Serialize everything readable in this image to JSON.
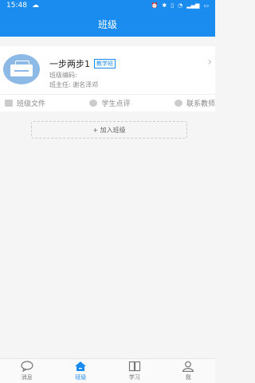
{
  "status": {
    "time": "15:48",
    "icons": [
      "cloud-icon",
      "battery-icon"
    ]
  },
  "header": {
    "title": "班级"
  },
  "class_card": {
    "name": "一步两步1",
    "badge": "教学班",
    "code_label": "班级编码:",
    "teacher_label": "班主任: 谢名泽邓"
  },
  "actions": [
    {
      "label": "班级文件"
    },
    {
      "label": "学生点评"
    },
    {
      "label": "联系教师"
    }
  ],
  "join_button": {
    "label": "+ 加入班级"
  },
  "tabs": [
    {
      "label": "消息",
      "active": false
    },
    {
      "label": "班级",
      "active": true
    },
    {
      "label": "学习",
      "active": false
    },
    {
      "label": "我",
      "active": false
    }
  ],
  "colors": {
    "primary": "#1a8cf0",
    "background": "#f5f5f5"
  }
}
